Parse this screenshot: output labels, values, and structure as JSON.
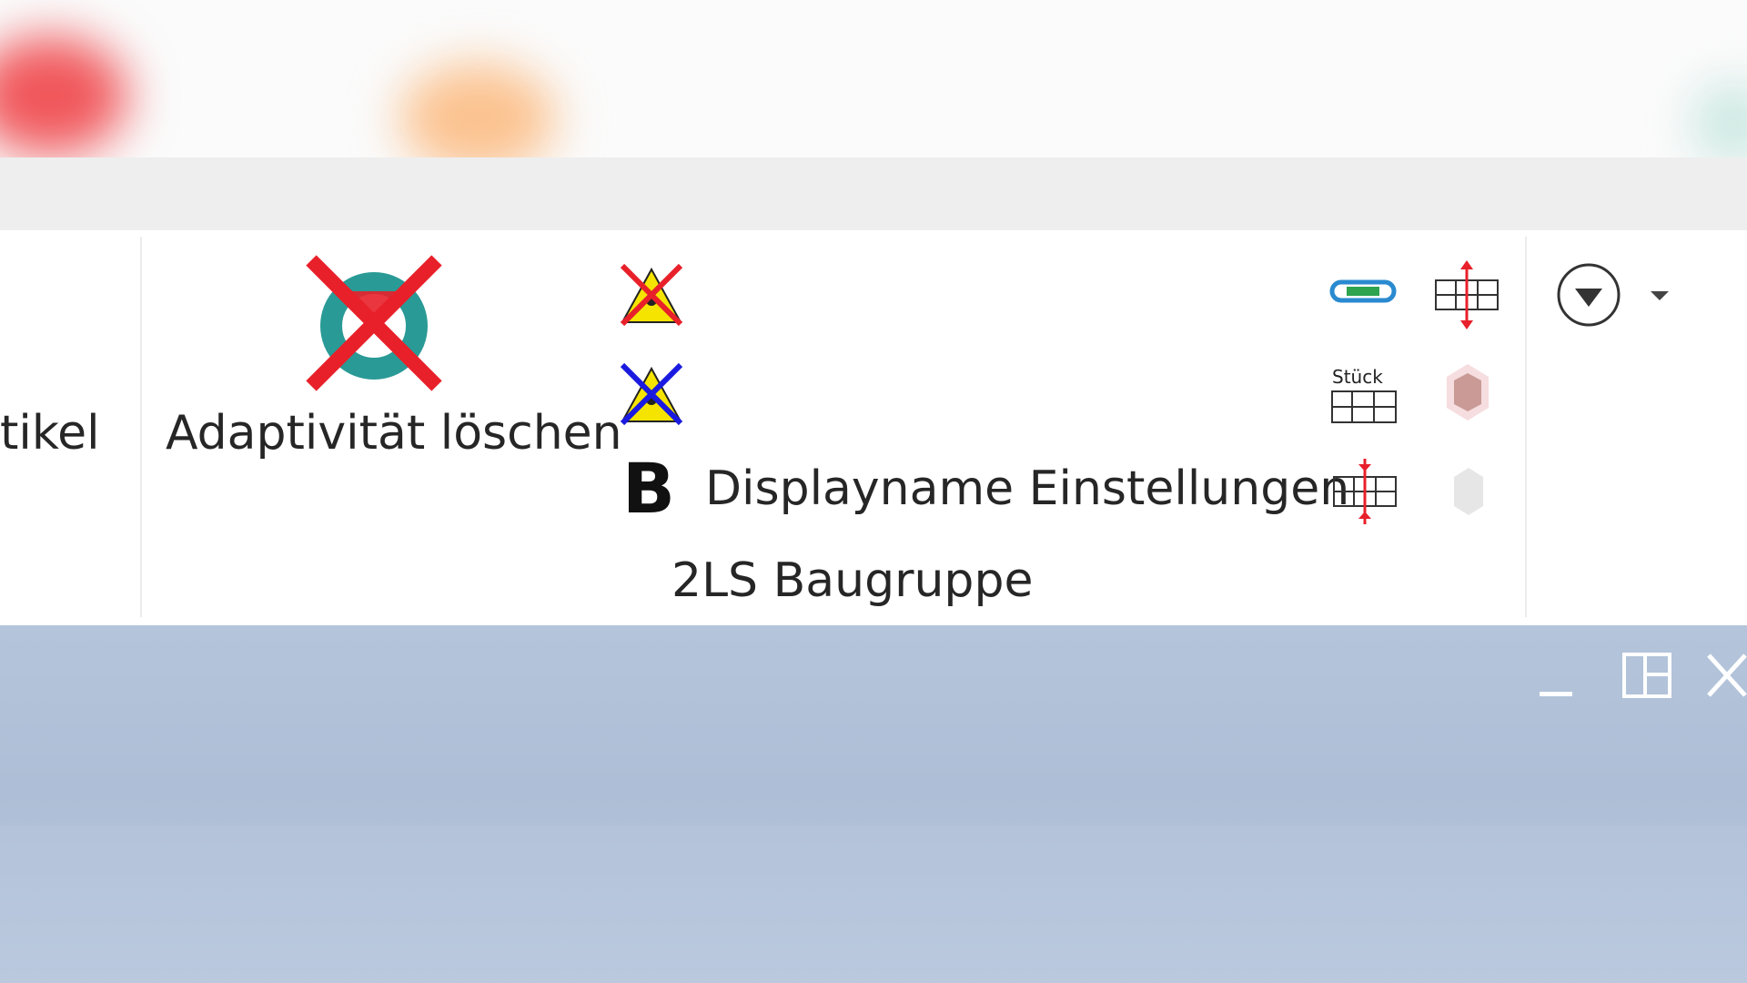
{
  "ribbon": {
    "partial_left_label": "tikel",
    "adaptivity_delete_label": "Adaptivität löschen",
    "displayname_settings_label": "Displayname Einstellungen",
    "group_title": "2LS Baugruppe",
    "small_icons_right": [
      {
        "icon": "chain-link-icon"
      },
      {
        "icon": "split-resize-icon"
      },
      {
        "icon": "stueck-table-icon",
        "text": "Stück"
      },
      {
        "icon": "hexagon-icon"
      },
      {
        "icon": "merge-resize-icon"
      },
      {
        "icon": "hexagon-disabled-icon"
      }
    ]
  },
  "window_controls": [
    "minimize",
    "restore",
    "close"
  ],
  "colors": {
    "accent_red": "#e8202a",
    "accent_blue": "#1a1ae0",
    "teal": "#2a9a96",
    "yellow": "#f5e400",
    "background_blue": "#b2c3da"
  }
}
